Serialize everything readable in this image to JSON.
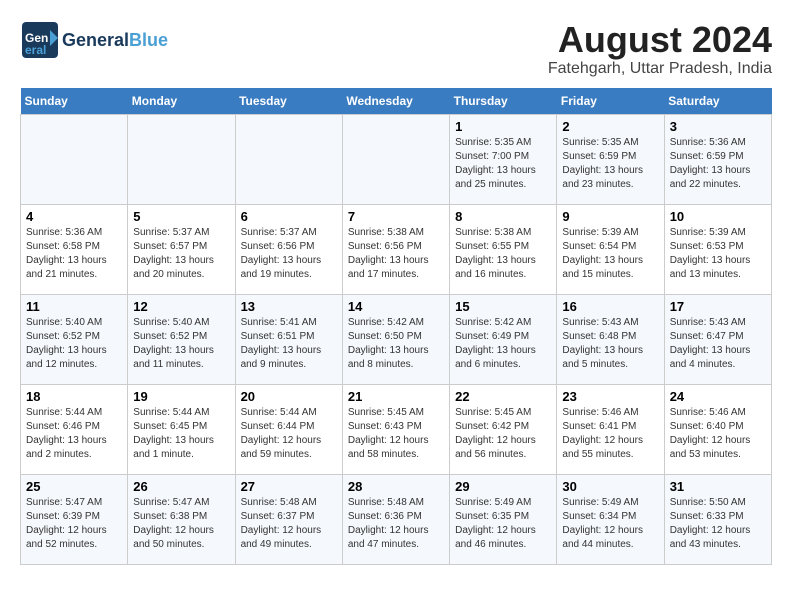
{
  "logo": {
    "line1": "General",
    "line2": "Blue",
    "tagline": ""
  },
  "title": "August 2024",
  "subtitle": "Fatehgarh, Uttar Pradesh, India",
  "days_of_week": [
    "Sunday",
    "Monday",
    "Tuesday",
    "Wednesday",
    "Thursday",
    "Friday",
    "Saturday"
  ],
  "weeks": [
    [
      {
        "day": "",
        "info": ""
      },
      {
        "day": "",
        "info": ""
      },
      {
        "day": "",
        "info": ""
      },
      {
        "day": "",
        "info": ""
      },
      {
        "day": "1",
        "info": "Sunrise: 5:35 AM\nSunset: 7:00 PM\nDaylight: 13 hours\nand 25 minutes."
      },
      {
        "day": "2",
        "info": "Sunrise: 5:35 AM\nSunset: 6:59 PM\nDaylight: 13 hours\nand 23 minutes."
      },
      {
        "day": "3",
        "info": "Sunrise: 5:36 AM\nSunset: 6:59 PM\nDaylight: 13 hours\nand 22 minutes."
      }
    ],
    [
      {
        "day": "4",
        "info": "Sunrise: 5:36 AM\nSunset: 6:58 PM\nDaylight: 13 hours\nand 21 minutes."
      },
      {
        "day": "5",
        "info": "Sunrise: 5:37 AM\nSunset: 6:57 PM\nDaylight: 13 hours\nand 20 minutes."
      },
      {
        "day": "6",
        "info": "Sunrise: 5:37 AM\nSunset: 6:56 PM\nDaylight: 13 hours\nand 19 minutes."
      },
      {
        "day": "7",
        "info": "Sunrise: 5:38 AM\nSunset: 6:56 PM\nDaylight: 13 hours\nand 17 minutes."
      },
      {
        "day": "8",
        "info": "Sunrise: 5:38 AM\nSunset: 6:55 PM\nDaylight: 13 hours\nand 16 minutes."
      },
      {
        "day": "9",
        "info": "Sunrise: 5:39 AM\nSunset: 6:54 PM\nDaylight: 13 hours\nand 15 minutes."
      },
      {
        "day": "10",
        "info": "Sunrise: 5:39 AM\nSunset: 6:53 PM\nDaylight: 13 hours\nand 13 minutes."
      }
    ],
    [
      {
        "day": "11",
        "info": "Sunrise: 5:40 AM\nSunset: 6:52 PM\nDaylight: 13 hours\nand 12 minutes."
      },
      {
        "day": "12",
        "info": "Sunrise: 5:40 AM\nSunset: 6:52 PM\nDaylight: 13 hours\nand 11 minutes."
      },
      {
        "day": "13",
        "info": "Sunrise: 5:41 AM\nSunset: 6:51 PM\nDaylight: 13 hours\nand 9 minutes."
      },
      {
        "day": "14",
        "info": "Sunrise: 5:42 AM\nSunset: 6:50 PM\nDaylight: 13 hours\nand 8 minutes."
      },
      {
        "day": "15",
        "info": "Sunrise: 5:42 AM\nSunset: 6:49 PM\nDaylight: 13 hours\nand 6 minutes."
      },
      {
        "day": "16",
        "info": "Sunrise: 5:43 AM\nSunset: 6:48 PM\nDaylight: 13 hours\nand 5 minutes."
      },
      {
        "day": "17",
        "info": "Sunrise: 5:43 AM\nSunset: 6:47 PM\nDaylight: 13 hours\nand 4 minutes."
      }
    ],
    [
      {
        "day": "18",
        "info": "Sunrise: 5:44 AM\nSunset: 6:46 PM\nDaylight: 13 hours\nand 2 minutes."
      },
      {
        "day": "19",
        "info": "Sunrise: 5:44 AM\nSunset: 6:45 PM\nDaylight: 13 hours\nand 1 minute."
      },
      {
        "day": "20",
        "info": "Sunrise: 5:44 AM\nSunset: 6:44 PM\nDaylight: 12 hours\nand 59 minutes."
      },
      {
        "day": "21",
        "info": "Sunrise: 5:45 AM\nSunset: 6:43 PM\nDaylight: 12 hours\nand 58 minutes."
      },
      {
        "day": "22",
        "info": "Sunrise: 5:45 AM\nSunset: 6:42 PM\nDaylight: 12 hours\nand 56 minutes."
      },
      {
        "day": "23",
        "info": "Sunrise: 5:46 AM\nSunset: 6:41 PM\nDaylight: 12 hours\nand 55 minutes."
      },
      {
        "day": "24",
        "info": "Sunrise: 5:46 AM\nSunset: 6:40 PM\nDaylight: 12 hours\nand 53 minutes."
      }
    ],
    [
      {
        "day": "25",
        "info": "Sunrise: 5:47 AM\nSunset: 6:39 PM\nDaylight: 12 hours\nand 52 minutes."
      },
      {
        "day": "26",
        "info": "Sunrise: 5:47 AM\nSunset: 6:38 PM\nDaylight: 12 hours\nand 50 minutes."
      },
      {
        "day": "27",
        "info": "Sunrise: 5:48 AM\nSunset: 6:37 PM\nDaylight: 12 hours\nand 49 minutes."
      },
      {
        "day": "28",
        "info": "Sunrise: 5:48 AM\nSunset: 6:36 PM\nDaylight: 12 hours\nand 47 minutes."
      },
      {
        "day": "29",
        "info": "Sunrise: 5:49 AM\nSunset: 6:35 PM\nDaylight: 12 hours\nand 46 minutes."
      },
      {
        "day": "30",
        "info": "Sunrise: 5:49 AM\nSunset: 6:34 PM\nDaylight: 12 hours\nand 44 minutes."
      },
      {
        "day": "31",
        "info": "Sunrise: 5:50 AM\nSunset: 6:33 PM\nDaylight: 12 hours\nand 43 minutes."
      }
    ]
  ]
}
